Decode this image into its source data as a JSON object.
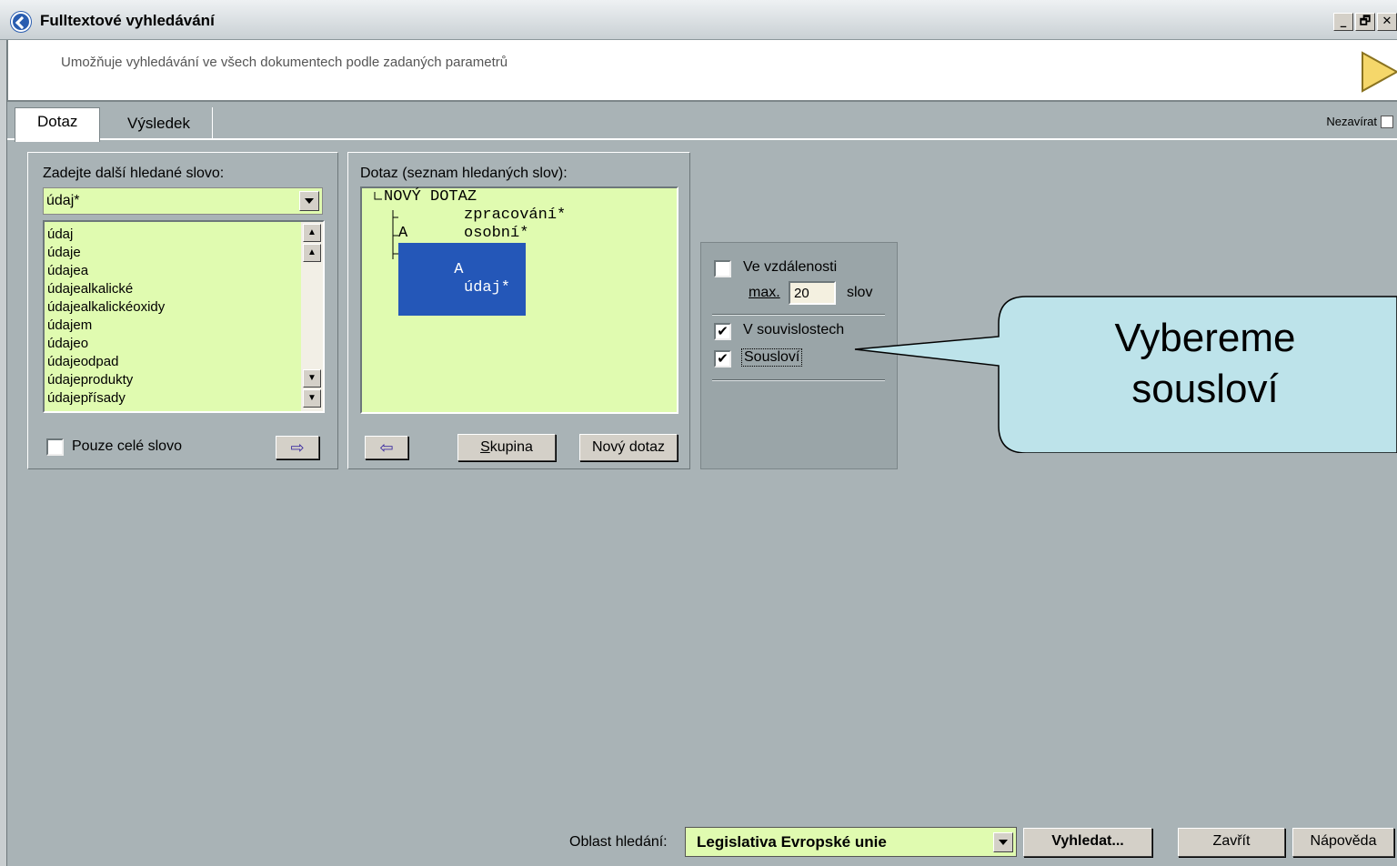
{
  "window": {
    "title": "Fulltextové vyhledávání",
    "controls": [
      "_",
      "🗗",
      "✕"
    ]
  },
  "description": "Umožňuje vyhledávání ve všech dokumentech podle zadaných parametrů",
  "tabs": [
    {
      "label": "Dotaz",
      "active": true
    },
    {
      "label": "Výsledek",
      "active": false
    }
  ],
  "nezavirat_label": "Nezavírat",
  "words_panel": {
    "label": "Zadejte další hledané slovo:",
    "input_value": "údaj*",
    "list": [
      "údaj",
      "údaje",
      "údajea",
      "údajealkalické",
      "údajealkalickéoxidy",
      "údajem",
      "údajeo",
      "údajeodpad",
      "údajeprodukty",
      "údajepřísady"
    ],
    "whole_word_label": "Pouze celé slovo",
    "add_arrow": "⇨"
  },
  "query_panel": {
    "label": "Dotaz (seznam hledaných slov):",
    "root": "NOVÝ DOTAZ",
    "items": [
      {
        "op": "",
        "term": "zpracování*"
      },
      {
        "op": "A",
        "term": "osobní*"
      },
      {
        "op": "A",
        "term": "údaj*"
      }
    ],
    "remove_arrow": "⇦",
    "group_button": "Skupina",
    "group_button_key": "S",
    "new_query_button": "Nový dotaz"
  },
  "options_panel": {
    "distance_label": "Ve vzdálenosti",
    "max_label": "max.",
    "max_value": "20",
    "words_unit": "slov",
    "contexts_label": "V souvislostech",
    "phrase_label": "Sousloví",
    "distance_checked": false,
    "contexts_checked": true,
    "phrase_checked": true
  },
  "callout": {
    "line1": "Vybereme",
    "line2": "sousloví"
  },
  "bottom": {
    "area_label": "Oblast hledání:",
    "area_value": "Legislativa Evropské unie",
    "search_button": "Vyhledat...",
    "close_button": "Zavřít",
    "help_button": "Nápověda"
  },
  "colors": {
    "field_bg": "#e0fbb0",
    "selection": "#2457b8",
    "callout_fill": "#bde3ea"
  }
}
